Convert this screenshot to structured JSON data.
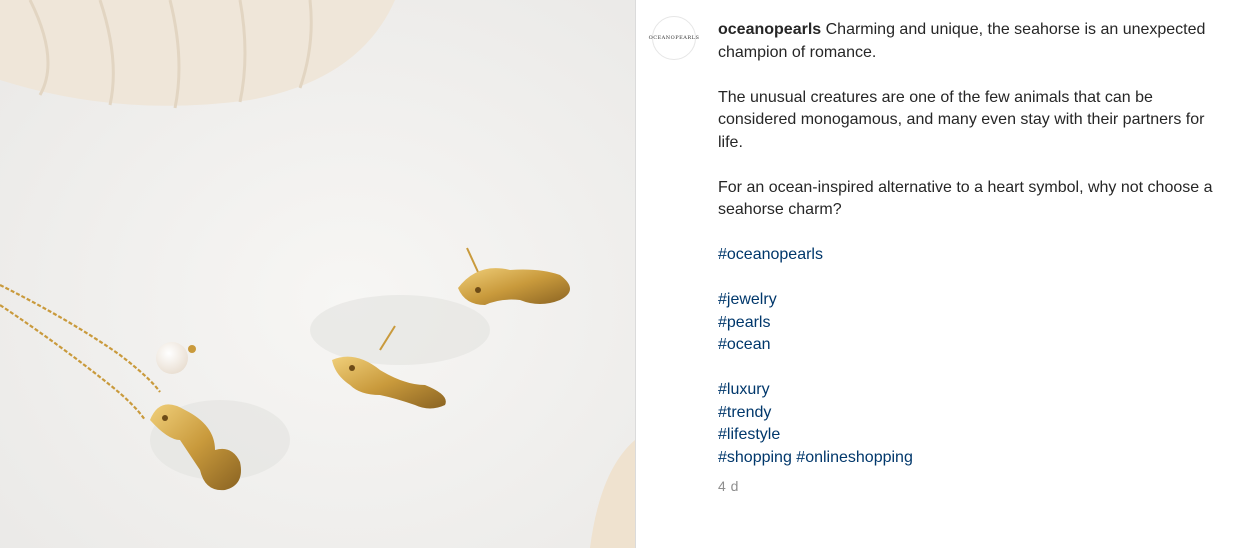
{
  "post": {
    "username": "oceanopearls",
    "avatar_text": "OCEANOPEARLS",
    "caption_lead": "Charming and unique, the seahorse is an unexpected champion of romance.",
    "caption_para2": "The unusual creatures are one of the few animals that can be considered monogamous, and many even stay with their partners for life.",
    "caption_para3": "For an ocean-inspired alternative to a heart symbol, why not choose a seahorse charm?",
    "hashtags": {
      "brand": "#oceanopearls",
      "group1": [
        "#jewelry",
        "#pearls",
        "#ocean"
      ],
      "group2": [
        "#luxury",
        "#trendy",
        "#lifestyle"
      ],
      "group3": [
        "#shopping",
        "#onlineshopping"
      ]
    },
    "timestamp": "4 d"
  },
  "colors": {
    "link": "#00376b",
    "text": "#262626",
    "muted": "#8e8e8e",
    "gold": "#c99a3c"
  }
}
